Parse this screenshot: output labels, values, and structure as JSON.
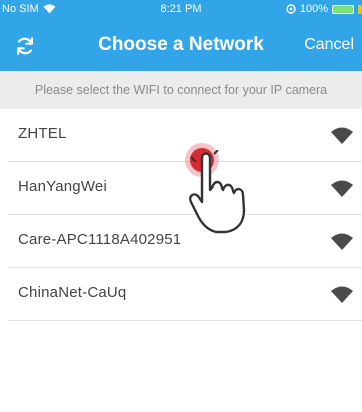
{
  "status_bar": {
    "carrier": "No SIM",
    "time": "8:21 PM",
    "battery": "100%"
  },
  "nav": {
    "title": "Choose a Network",
    "cancel_label": "Cancel",
    "refresh_icon": "refresh-icon"
  },
  "instruction": "Please select the WIFI to connect for your IP camera",
  "networks": [
    {
      "name": "ZHTEL"
    },
    {
      "name": "HanYangWei"
    },
    {
      "name": "Care-APC1118A402951"
    },
    {
      "name": "ChinaNet-CaUq"
    }
  ],
  "colors": {
    "header": "#32a4e8",
    "instruction_bg": "#ececec",
    "tap_indicator": "#d82a32"
  }
}
